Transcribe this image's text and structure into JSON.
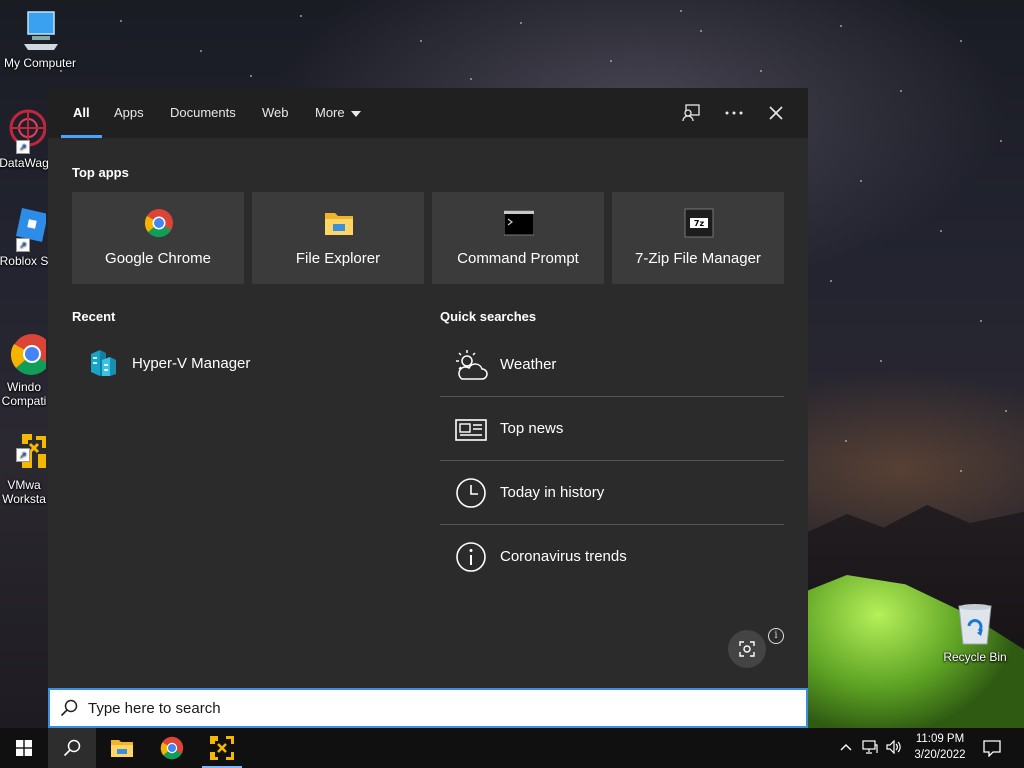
{
  "desktop": {
    "icons": [
      {
        "label": "My Computer"
      },
      {
        "label": "DataWag"
      },
      {
        "label": "Roblox S"
      },
      {
        "label": "Windo\nCompati"
      },
      {
        "label": "VMwa\nWorksta"
      },
      {
        "label": "Recycle Bin"
      }
    ]
  },
  "search_panel": {
    "tabs": [
      {
        "label": "All",
        "active": true
      },
      {
        "label": "Apps"
      },
      {
        "label": "Documents"
      },
      {
        "label": "Web"
      },
      {
        "label": "More"
      }
    ],
    "header_icons": [
      "feedback-icon",
      "more-options-icon",
      "close-icon"
    ],
    "top_apps": {
      "title": "Top apps",
      "items": [
        {
          "label": "Google Chrome",
          "icon": "chrome-icon"
        },
        {
          "label": "File Explorer",
          "icon": "folder-icon"
        },
        {
          "label": "Command Prompt",
          "icon": "cmd-icon"
        },
        {
          "label": "7-Zip File Manager",
          "icon": "7zip-icon"
        }
      ]
    },
    "recent": {
      "title": "Recent",
      "items": [
        {
          "label": "Hyper-V Manager",
          "icon": "hyperv-icon"
        }
      ]
    },
    "quick_searches": {
      "title": "Quick searches",
      "items": [
        {
          "label": "Weather",
          "icon": "weather-icon"
        },
        {
          "label": "Top news",
          "icon": "news-icon"
        },
        {
          "label": "Today in history",
          "icon": "clock-icon"
        },
        {
          "label": "Coronavirus trends",
          "icon": "info-icon"
        }
      ]
    },
    "info_glyph": "i"
  },
  "search_box": {
    "placeholder": "Type here to search",
    "value": ""
  },
  "taskbar": {
    "apps": [
      "windows-start",
      "search",
      "file-explorer",
      "chrome",
      "vmware-workstation"
    ],
    "clock": {
      "time": "11:09 PM",
      "date": "3/20/2022"
    }
  },
  "colors": {
    "accent": "#4aa3ff",
    "panel_bg": "#2b2b2b",
    "tile_bg": "#3b3b3b",
    "taskbar_bg": "#101010"
  }
}
